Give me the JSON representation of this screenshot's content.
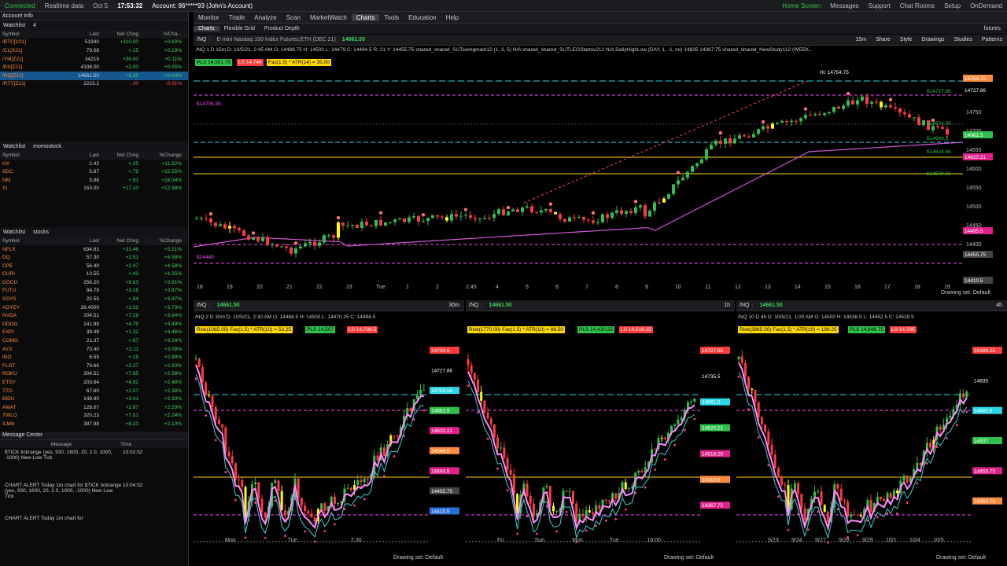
{
  "topbar": {
    "connected": "Connected",
    "realtime": "Realtime data",
    "date": "Oct 5",
    "time": "17:53:32",
    "account": "Account: 86*****93 (John's Account)",
    "home_screen": "Home Screen",
    "messages": "Messages",
    "support": "Support",
    "chat_rooms": "Chat Rooms",
    "setup": "Setup",
    "ondemand": "OnDemand"
  },
  "left": {
    "account_info": "Account Info",
    "watchlists": [
      {
        "title": "Watchlist",
        "name": "4",
        "columns": [
          "Symbol",
          "Last",
          "Net Chng",
          "%Cha..."
        ],
        "rows": [
          {
            "sym": "/BTC[V21]",
            "last": "51940",
            "chg": "+310.00",
            "pct": "+0.60%",
            "dir": "pos"
          },
          {
            "sym": "/CL[X21]",
            "last": "79.08",
            "chg": "+.15",
            "pct": "+0.19%",
            "dir": "pos"
          },
          {
            "sym": "/YM[Z21]",
            "last": "34219",
            "chg": "+36.00",
            "pct": "+0.11%",
            "dir": "pos"
          },
          {
            "sym": "/ES[Z21]",
            "last": "4336.00",
            "chg": "+2.00",
            "pct": "+0.05%",
            "dir": "pos"
          },
          {
            "sym": "/NQ[Z21]",
            "last": "14661.50",
            "chg": "+6.25",
            "pct": "+0.04%",
            "dir": "pos",
            "sel": true
          },
          {
            "sym": "/RTY[Z21]",
            "last": "2223.2",
            "chg": "-.30",
            "pct": "-0.01%",
            "dir": "neg"
          }
        ]
      },
      {
        "title": "Watchlist",
        "name": "momostock",
        "columns": [
          "Symbol",
          "Last",
          "Net Chng",
          "%Change"
        ],
        "rows": [
          {
            "sym": "HX",
            "last": "2.42",
            "chg": "+.25",
            "pct": "+11.52%",
            "dir": "pos"
          },
          {
            "sym": "SDC",
            "last": "5.87",
            "chg": "+.79",
            "pct": "+15.55%",
            "dir": "pos"
          },
          {
            "sym": "NM",
            "last": "5.86",
            "chg": "+.81",
            "pct": "+16.04%",
            "dir": "pos"
          },
          {
            "sym": "SI",
            "last": "153.00",
            "chg": "+17.10",
            "pct": "+12.58%",
            "dir": "pos"
          }
        ]
      },
      {
        "title": "Watchlist",
        "name": "stocks",
        "columns": [
          "Symbol",
          "Last",
          "Net Chng",
          "%Change"
        ],
        "rows": [
          {
            "sym": "NFLX",
            "last": "634.81",
            "chg": "+31.46",
            "pct": "+5.21%",
            "dir": "pos"
          },
          {
            "sym": "DQ",
            "last": "57.30",
            "chg": "+2.51",
            "pct": "+4.58%",
            "dir": "pos"
          },
          {
            "sym": "CPE",
            "last": "56.40",
            "chg": "+2.47",
            "pct": "+4.58%",
            "dir": "pos"
          },
          {
            "sym": "CURI",
            "last": "10.55",
            "chg": "+.43",
            "pct": "+4.25%",
            "dir": "pos"
          },
          {
            "sym": "DOCU",
            "last": "256.20",
            "chg": "+9.63",
            "pct": "+3.91%",
            "dir": "pos"
          },
          {
            "sym": "FUTU",
            "last": "84.79",
            "chg": "+3.16",
            "pct": "+3.87%",
            "dir": "pos"
          },
          {
            "sym": "SSYS",
            "last": "22.55",
            "chg": "+.84",
            "pct": "+3.87%",
            "dir": "pos"
          },
          {
            "sym": "ADYEY",
            "last": "28.4000",
            "chg": "+1.02",
            "pct": "+3.73%",
            "dir": "pos"
          },
          {
            "sym": "NVDA",
            "last": "204.51",
            "chg": "+7.19",
            "pct": "+3.64%",
            "dir": "pos"
          },
          {
            "sym": "DDOG",
            "last": "141.89",
            "chg": "+4.79",
            "pct": "+3.49%",
            "dir": "pos"
          },
          {
            "sym": "EXPI",
            "last": "39.49",
            "chg": "+1.32",
            "pct": "+3.46%",
            "dir": "pos"
          },
          {
            "sym": "COMO",
            "last": "21.37",
            "chg": "+.67",
            "pct": "+3.24%",
            "dir": "pos"
          },
          {
            "sym": "AYX",
            "last": "70.40",
            "chg": "+2.11",
            "pct": "+3.09%",
            "dir": "pos"
          },
          {
            "sym": "INO",
            "last": "6.55",
            "chg": "+.19",
            "pct": "+2.99%",
            "dir": "pos"
          },
          {
            "sym": "FLGT",
            "last": "79.66",
            "chg": "+2.27",
            "pct": "+2.93%",
            "dir": "pos"
          },
          {
            "sym": "ROKU",
            "last": "304.51",
            "chg": "+7.65",
            "pct": "+2.58%",
            "dir": "pos"
          },
          {
            "sym": "ETSY",
            "last": "203.64",
            "chg": "+4.92",
            "pct": "+2.48%",
            "dir": "pos"
          },
          {
            "sym": "TTD",
            "last": "67.60",
            "chg": "+1.57",
            "pct": "+2.38%",
            "dir": "pos"
          },
          {
            "sym": "BIDU",
            "last": "149.80",
            "chg": "+3.41",
            "pct": "+2.33%",
            "dir": "pos"
          },
          {
            "sym": "AMAT",
            "last": "128.07",
            "chg": "+2.87",
            "pct": "+2.29%",
            "dir": "pos"
          },
          {
            "sym": "TWLO",
            "last": "320.23",
            "chg": "+7.01",
            "pct": "+2.24%",
            "dir": "pos"
          },
          {
            "sym": "ILMN",
            "last": "387.98",
            "chg": "+8.10",
            "pct": "+2.13%",
            "dir": "pos"
          }
        ]
      }
    ],
    "message_center": {
      "title": "Message Center",
      "col_message": "Message",
      "col_time": "Time",
      "messages": [
        {
          "text": "$TICK tickrange (yes, 930, 1600, 20, 2.0, 1000, -1000) New Low Tick",
          "time": "10:02:52"
        },
        {
          "text": "CHART ALERT Today 1m chart for $TICK tickrange (yes, 930, 1600, 20, 2.0, 1000, -1000) New Low Tick",
          "time": "10:04:52"
        },
        {
          "text": "CHART ALERT Today 1m chart for",
          "time": ""
        }
      ]
    }
  },
  "main": {
    "tabs": [
      "Monitor",
      "Trade",
      "Analyze",
      "Scan",
      "MarketWatch",
      "Charts",
      "Tools",
      "Education",
      "Help"
    ],
    "active_tab": "Charts",
    "subtabs": [
      "Charts",
      "Flexible Grid",
      "Product Depth"
    ],
    "futures_label": "futures",
    "top_chart": {
      "symbol": "/NQ",
      "description": "E-mini Nasdaq 100 Index Futures,ETH (DEC 21)",
      "price": "14661.50",
      "info": "/NQ 1 D 15m  D: 10/5/21, 2:45 AM  O: 14488.75  H: 14500  L: 14479  C: 14494.5  R: 21  Y: 14455.75  shared_shared_SUTswingmark12 (1, 3, 5)  N/A  shared_shared_SUTLEGStartsv212  N/A  DailyHighLow (DAY, 1, -1, no)  14835  14367.75  shared_shared_NewStudy112 (WEEK...",
      "pls": "PLS 14,501.75",
      "ls": "LS 14,746",
      "fac": "Fac(1.5) * ATR(14) = 35.00",
      "interval": "15m",
      "toolbar": [
        "Share",
        "Style",
        "Drawings",
        "Studies",
        "Patterns"
      ],
      "x_labels": [
        "18",
        "19",
        "20",
        "21",
        "22",
        "23",
        "Tue",
        "1",
        "2",
        "2:45",
        "4",
        "5",
        "6",
        "7",
        "8",
        "9",
        "10",
        "11",
        "12",
        "13",
        "14",
        "15",
        "16",
        "17",
        "18",
        "19"
      ],
      "y_labels": [
        "14750",
        "14700",
        "14650",
        "14600",
        "14550",
        "14500",
        "14450",
        "14400"
      ],
      "tags": [
        {
          "text": "14754.75",
          "color": "#ff8a3d"
        },
        {
          "text": "14727.86",
          "color": "#000"
        },
        {
          "text": "14661.5",
          "color": "#2ec04a"
        },
        {
          "text": "14620.21",
          "color": "#e0218a"
        },
        {
          "text": "14495.5",
          "color": "#e0218a"
        },
        {
          "text": "14455.75",
          "color": "#444"
        },
        {
          "text": "14410.5",
          "color": "#444"
        }
      ],
      "line_labels": [
        "$14705.39",
        "$14445",
        "$14727.86",
        "$14674.00",
        "$14649.5",
        "$14624.96",
        "$14590.01",
        "Hi: 14754.75"
      ],
      "drawing_set": "Drawing set: Default"
    },
    "panels": [
      {
        "symbol": "/NQ",
        "price": "14661.50",
        "interval": "30m",
        "info": "/NQ 2 D 30m  D: 10/5/21, 2:30 AM  O: 14484.5  H: 14500  L: 14470.25  C: 14494.5",
        "risk": "Risk(1065.00) Fac(1.5) * ATR(10) = 53.25",
        "pls": "PLS 14,507",
        "ls": "LS 14,739.5",
        "x_labels": [
          "Mon",
          "Tue",
          "2:30"
        ],
        "tags": [
          "14739.5",
          "14727.86",
          "14703.56",
          "14661.5",
          "14620.21",
          "14549.5",
          "14494.5",
          "14455.75",
          "14410.5"
        ],
        "drawing_set": "Drawing set: Default"
      },
      {
        "symbol": "/NQ",
        "price": "14661.50",
        "interval": "1h",
        "info": "",
        "risk": "Risk(1770.00) Fac(1.5) * ATR(10) = 88.50",
        "pls": "PLS 14,430.25",
        "ls": "LS 14,518.25",
        "x_labels": [
          "Fri",
          "Sun",
          "Mon",
          "Tue",
          "16:00"
        ],
        "tags": [
          "14727.86",
          "14735.5",
          "14661.5",
          "14620.21",
          "14518.25",
          "14410.5",
          "14367.75"
        ],
        "drawing_set": "Drawing set: Default"
      },
      {
        "symbol": "/NQ",
        "price": "14661.50",
        "interval": "4h",
        "info": "/NQ 10 D 4h  D: 10/5/21, 1:00 AM  O: 14500  H: 14538.5  L: 14452.5  C: 14529.5",
        "risk": "Risk(3985.00) Fac(1.5) * ATR(10) = 199.25",
        "pls": "PLS 14,846.75",
        "ls": "LS 14,785",
        "x_labels": [
          "9/23",
          "9/24",
          "9/27",
          "9/28",
          "9/29",
          "10/1",
          "10/4",
          "10/5"
        ],
        "tags": [
          "15399.25",
          "14835",
          "14661.5",
          "14537",
          "14455.75",
          "14367.75"
        ],
        "drawing_set": "Drawing set: Default"
      }
    ]
  },
  "colors": {
    "up": "#2ec04a",
    "down": "#ff3b3b",
    "signal": "#ffff00",
    "ma": "#d256d6",
    "level": "#e0218a",
    "cyan": "#2bd6e6"
  }
}
